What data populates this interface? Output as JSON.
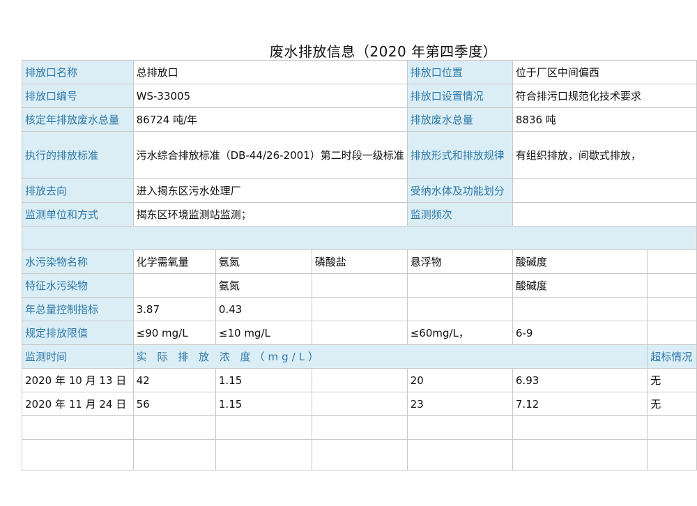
{
  "title": "废水排放信息（2020 年第四季度）",
  "colors": {
    "label_bg": "#dbeef6",
    "label_text": "#2e78a8",
    "border": "#c8c8c8"
  },
  "outlet": {
    "name_label": "排放口名称",
    "name": "总排放口",
    "position_label": "排放口位置",
    "position": "位于厂区中间偏西",
    "code_label": "排放口编号",
    "code": "WS-33005",
    "setup_label": "排放口设置情况",
    "setup": "符合排污口规范化技术要求",
    "approved_label": "核定年排放废水总量",
    "approved": "86724 吨/年",
    "total_label": "排放废水总量",
    "total": "8836 吨",
    "standard_label": "执行的排放标准",
    "standard": "污水综合排放标准（DB-44/26-2001）第二时段一级标准",
    "pattern_label": "排放形式和排放规律",
    "pattern": "有组织排放，间歇式排放，",
    "dest_label": "排放去向",
    "dest": "进入揭东区污水处理厂",
    "receiving_label": "受纳水体及功能划分",
    "receiving": "",
    "monitor_label": "监测单位和方式",
    "monitor": "揭东区环境监测站监测；",
    "freq_label": "监测频次",
    "freq": ""
  },
  "pollutants": {
    "names_label": "水污染物名称",
    "names": [
      "化学需氧量",
      "氨氮",
      "磷酸盐",
      "悬浮物",
      "酸碱度",
      ""
    ],
    "char_label": "特征水污染物",
    "char": [
      "",
      "氨氮",
      "",
      "",
      "酸碱度",
      ""
    ],
    "annual_label": "年总量控制指标",
    "annual": [
      "3.87",
      "0.43",
      "",
      "",
      "",
      ""
    ],
    "limit_label": "规定排放限值",
    "limit": [
      "≤90 mg/L",
      "≤10 mg/L",
      "",
      "≤60mg/L，",
      "6-9",
      ""
    ]
  },
  "monitoring": {
    "time_label": "监测时间",
    "conc_label": "实 际 排 放 浓 度（mg/L）",
    "exceed_label": "超标情况",
    "rows": [
      {
        "date": "2020 年 10 月 13 日",
        "v": [
          "42",
          "1.15",
          "",
          "20",
          "6.93"
        ],
        "exceed": "无"
      },
      {
        "date": "2020 年 11 月 24 日",
        "v": [
          "56",
          "1.15",
          "",
          "23",
          "7.12"
        ],
        "exceed": "无"
      },
      {
        "date": "",
        "v": [
          "",
          "",
          "",
          "",
          ""
        ],
        "exceed": ""
      },
      {
        "date": "",
        "v": [
          "",
          "",
          "",
          "",
          ""
        ],
        "exceed": ""
      }
    ]
  }
}
